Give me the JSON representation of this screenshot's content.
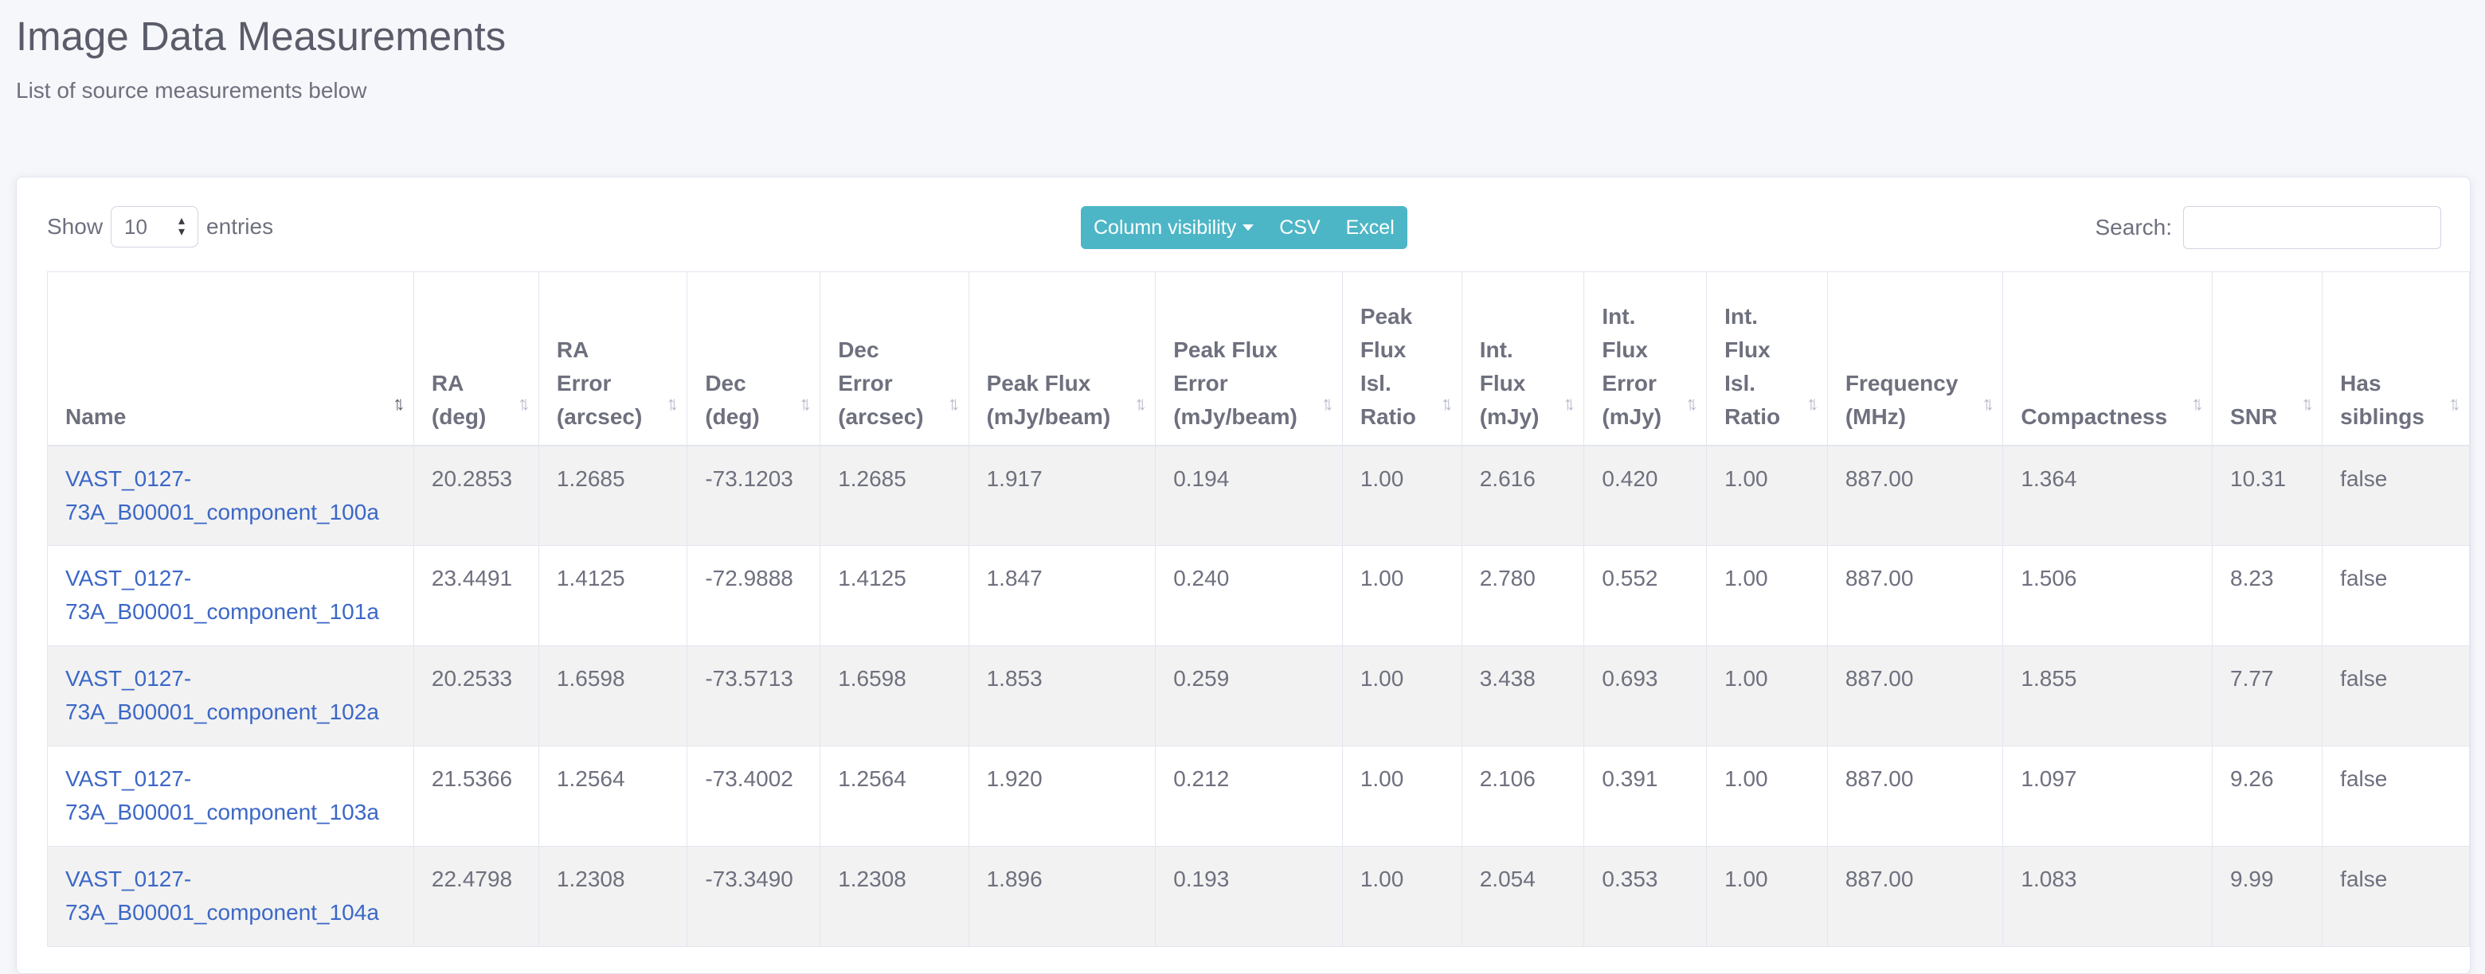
{
  "page": {
    "title": "Image Data Measurements",
    "subtitle": "List of source measurements below"
  },
  "controls": {
    "show_label": "Show",
    "page_size": "10",
    "entries_label": "entries",
    "buttons": {
      "column_visibility": "Column visibility",
      "csv": "CSV",
      "excel": "Excel"
    },
    "search_label": "Search:",
    "search_value": ""
  },
  "table": {
    "columns": [
      {
        "key": "name",
        "label": "Name",
        "sort": "asc"
      },
      {
        "key": "ra",
        "label": "RA (deg)",
        "sort": "none"
      },
      {
        "key": "ra_err",
        "label": "RA Error (arcsec)",
        "sort": "none"
      },
      {
        "key": "dec",
        "label": "Dec (deg)",
        "sort": "none"
      },
      {
        "key": "dec_err",
        "label": "Dec Error (arcsec)",
        "sort": "none"
      },
      {
        "key": "peak_flux",
        "label": "Peak Flux (mJy/beam)",
        "sort": "none"
      },
      {
        "key": "peak_flux_err",
        "label": "Peak Flux Error (mJy/beam)",
        "sort": "none"
      },
      {
        "key": "peak_flux_isl_ratio",
        "label": "Peak Flux Isl. Ratio",
        "sort": "none"
      },
      {
        "key": "int_flux",
        "label": "Int. Flux (mJy)",
        "sort": "none"
      },
      {
        "key": "int_flux_err",
        "label": "Int. Flux Error (mJy)",
        "sort": "none"
      },
      {
        "key": "int_flux_isl_ratio",
        "label": "Int. Flux Isl. Ratio",
        "sort": "none"
      },
      {
        "key": "frequency",
        "label": "Frequency (MHz)",
        "sort": "none"
      },
      {
        "key": "compactness",
        "label": "Compactness",
        "sort": "none"
      },
      {
        "key": "snr",
        "label": "SNR",
        "sort": "none"
      },
      {
        "key": "has_siblings",
        "label": "Has siblings",
        "sort": "none"
      }
    ],
    "rows": [
      [
        "VAST_0127-73A_B00001_component_100a",
        "20.2853",
        "1.2685",
        "-73.1203",
        "1.2685",
        "1.917",
        "0.194",
        "1.00",
        "2.616",
        "0.420",
        "1.00",
        "887.00",
        "1.364",
        "10.31",
        "false"
      ],
      [
        "VAST_0127-73A_B00001_component_101a",
        "23.4491",
        "1.4125",
        "-72.9888",
        "1.4125",
        "1.847",
        "0.240",
        "1.00",
        "2.780",
        "0.552",
        "1.00",
        "887.00",
        "1.506",
        "8.23",
        "false"
      ],
      [
        "VAST_0127-73A_B00001_component_102a",
        "20.2533",
        "1.6598",
        "-73.5713",
        "1.6598",
        "1.853",
        "0.259",
        "1.00",
        "3.438",
        "0.693",
        "1.00",
        "887.00",
        "1.855",
        "7.77",
        "false"
      ],
      [
        "VAST_0127-73A_B00001_component_103a",
        "21.5366",
        "1.2564",
        "-73.4002",
        "1.2564",
        "1.920",
        "0.212",
        "1.00",
        "2.106",
        "0.391",
        "1.00",
        "887.00",
        "1.097",
        "9.26",
        "false"
      ],
      [
        "VAST_0127-73A_B00001_component_104a",
        "22.4798",
        "1.2308",
        "-73.3490",
        "1.2308",
        "1.896",
        "0.193",
        "1.00",
        "2.054",
        "0.353",
        "1.00",
        "887.00",
        "1.083",
        "9.99",
        "false"
      ]
    ]
  }
}
